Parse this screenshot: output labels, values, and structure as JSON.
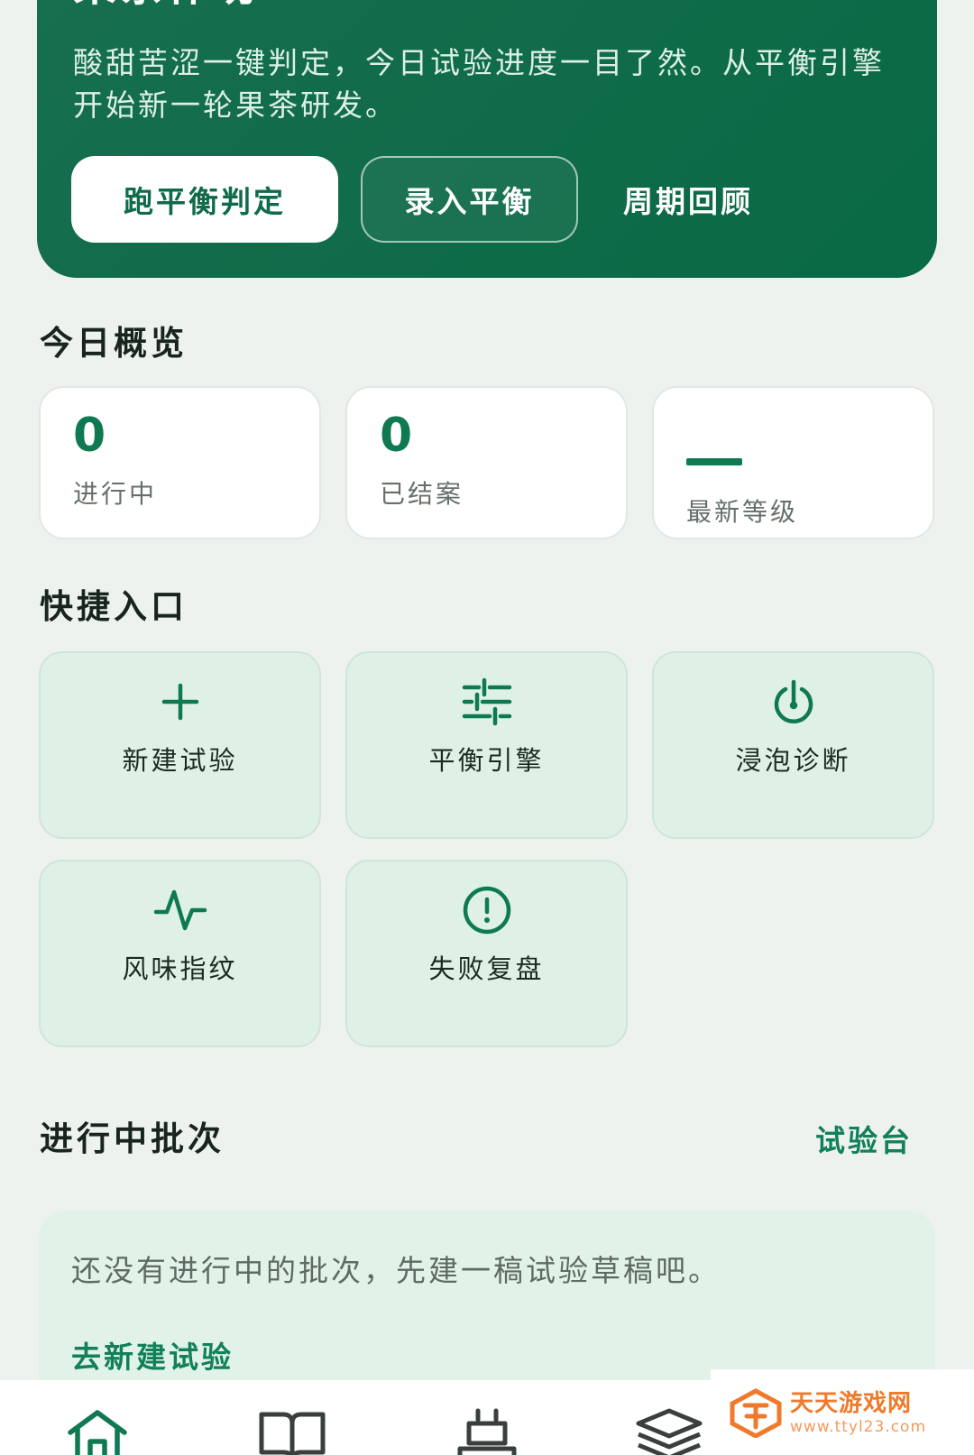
{
  "hero": {
    "title": "果茶作坊",
    "description": "酸甜苦涩一键判定，今日试验进度一目了然。从平衡引擎开始新一轮果茶研发。",
    "primary_button": "跑平衡判定",
    "outline_button": "录入平衡",
    "text_button": "周期回顾"
  },
  "overview": {
    "title": "今日概览",
    "stats": [
      {
        "value": "0",
        "label": "进行中"
      },
      {
        "value": "0",
        "label": "已结案"
      },
      {
        "value": "",
        "label": "最新等级"
      }
    ]
  },
  "quick": {
    "title": "快捷入口",
    "items": [
      {
        "label": "新建试验",
        "icon": "plus-icon"
      },
      {
        "label": "平衡引擎",
        "icon": "sliders-icon"
      },
      {
        "label": "浸泡诊断",
        "icon": "timer-icon"
      },
      {
        "label": "风味指纹",
        "icon": "pulse-icon"
      },
      {
        "label": "失败复盘",
        "icon": "alert-circle-icon"
      }
    ]
  },
  "in_progress": {
    "title": "进行中批次",
    "link": "试验台",
    "empty_text": "还没有进行中的批次，先建一稿试验草稿吧。",
    "empty_link": "去新建试验"
  },
  "nav": {
    "items": [
      {
        "icon": "home-icon"
      },
      {
        "icon": "book-icon"
      },
      {
        "icon": "kettle-icon"
      },
      {
        "icon": "layers-icon"
      }
    ]
  },
  "watermark": {
    "cn": "天天游戏网",
    "en": "www.ttyl23.com"
  },
  "colors": {
    "brand": "#0f6b49",
    "accent": "#12805a",
    "tile_bg": "#dff1e7",
    "page_bg": "#eef2ef"
  }
}
